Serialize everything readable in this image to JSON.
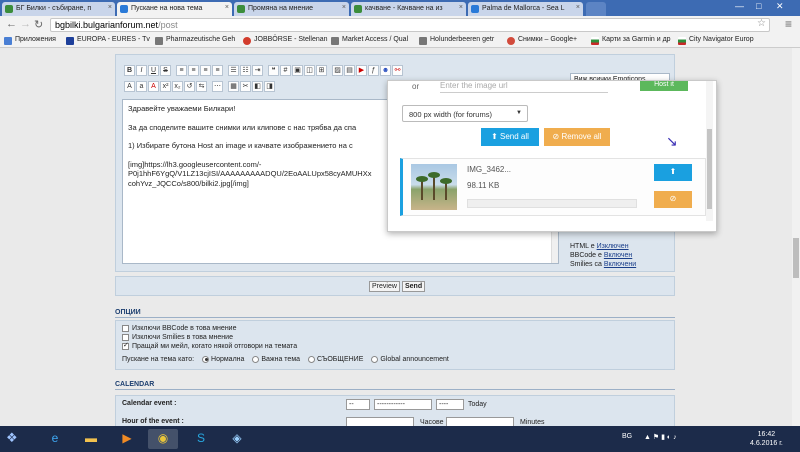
{
  "browser": {
    "tabs": [
      {
        "label": "БГ Билки - събиране, п",
        "color": "#3b8d3b",
        "active": false
      },
      {
        "label": "Пускане на нова тема",
        "color": "#2a7ad8",
        "active": true
      },
      {
        "label": "Промяна на мнение",
        "color": "#3b8d3b",
        "active": false
      },
      {
        "label": "качване - Качване на из",
        "color": "#3b8d3b",
        "active": false
      },
      {
        "label": "Palma de Mallorca - Sea L",
        "color": "#2a7ad8",
        "active": false
      }
    ],
    "url_host": "bgbilki.bulgarianforum.net",
    "url_path": "/post",
    "bookmarks": [
      {
        "label": "Приложения",
        "color": "#4a7fd4"
      },
      {
        "label": "EUROPA - EURES - Tv",
        "color": "#1d3f9a"
      },
      {
        "label": "Pharmazeutische Geh",
        "color": "#777777"
      },
      {
        "label": "JOBBÖRSE - Stellenan",
        "color": "#d23c2c"
      },
      {
        "label": "Market Access / Qual",
        "color": "#777777"
      },
      {
        "label": "Holunderbeeren getr",
        "color": "#777777"
      },
      {
        "label": "Снимки – Google+",
        "color": "#d24b3c"
      },
      {
        "label": "Карти за Garmin и др",
        "color": "#2d8f3c"
      },
      {
        "label": "City Navigator Europ",
        "color": "#c82828"
      }
    ]
  },
  "editor": {
    "lines": [
      "Здравейте уважаеми Билкари!",
      "",
      "За да споделите вашите снимки или клипове с нас трябва да спа",
      "",
      "1) Избирате бутона Host an image и качвате изображението на с",
      "",
      "[img]https://lh3.googleusercontent.com/-",
      "P0j1hhF6YgQ/V1LZ13cjISI/AAAAAAAAADQU/2EoAALUpx58cyAMUHXx",
      "cohYvz_JQCCo/s800/bilki2.jpg[/img]"
    ],
    "smiley_label": "Виж всички Emoticons",
    "bbinfo": [
      {
        "label": "HTML е",
        "value": "Изключен"
      },
      {
        "label": "BBCode е",
        "value": "Включен"
      },
      {
        "label": "Smilies са",
        "value": "Включени"
      }
    ]
  },
  "buttons": {
    "preview": "Preview",
    "send": "Send"
  },
  "options": {
    "heading": "ОПЦИИ",
    "items": [
      {
        "label": "Изключи BBCode в това мнение",
        "checked": false
      },
      {
        "label": "Изключи Smilies в това мнение",
        "checked": false
      },
      {
        "label": "Пращай ми мейл, когато някой отговори на темата",
        "checked": true
      }
    ],
    "post_as_label": "Пускане на тема като:",
    "post_types": [
      {
        "label": "Нормална",
        "selected": true
      },
      {
        "label": "Важна тема",
        "selected": false
      },
      {
        "label": "СЪОБЩЕНИЕ",
        "selected": false
      },
      {
        "label": "Global announcement",
        "selected": false
      }
    ]
  },
  "calendar": {
    "heading": "CALENDAR",
    "event_label": "Calendar event :",
    "sel1": "--",
    "sel2": "------------",
    "sel3": "----",
    "today": "Today",
    "hour_label": "Hour of the event :",
    "hours_unit": "Часове",
    "minutes_unit": "Minutes"
  },
  "upload": {
    "or": "or",
    "url_placeholder": "Enter the image url",
    "host_it": "Host it",
    "width_option": "800 px width (for forums)",
    "send_all": "Send all",
    "remove_all": "Remove all",
    "file_name": "IMG_3462...",
    "file_size": "98.11 KB",
    "progress": 0.0
  },
  "taskbar": {
    "lang": "BG",
    "time": "16:42",
    "date": "4.6.2016 г."
  }
}
